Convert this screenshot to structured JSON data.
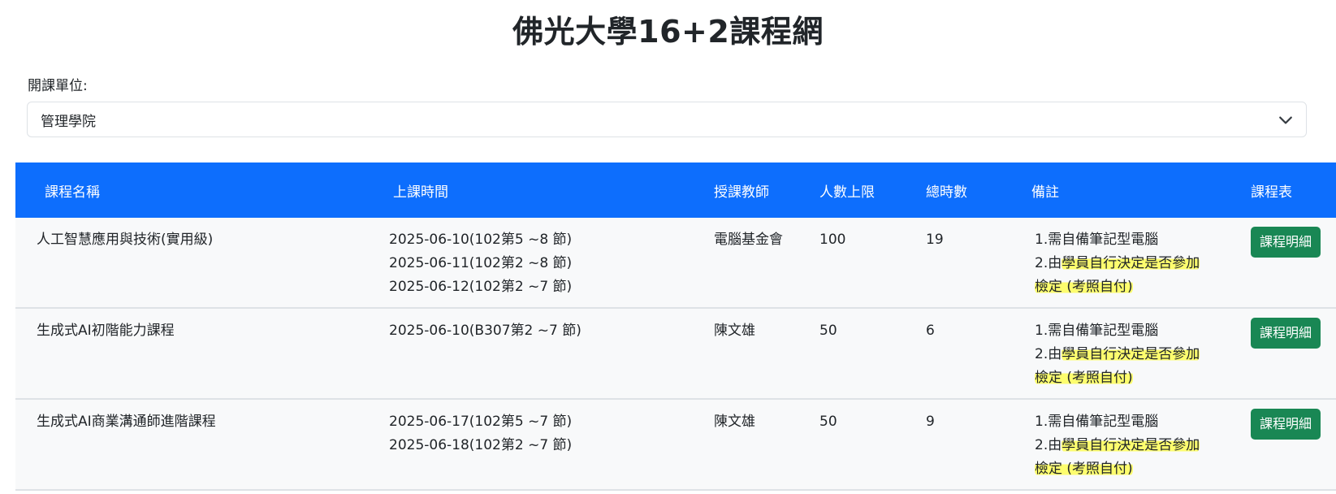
{
  "page": {
    "title": "佛光大學16+2課程網"
  },
  "filter": {
    "label": "開課單位:",
    "selected": "管理學院"
  },
  "table": {
    "headers": [
      "課程名稱",
      "上課時間",
      "授課教師",
      "人數上限",
      "總時數",
      "備註",
      "課程表"
    ],
    "rows": [
      {
        "name": "人工智慧應用與技術(實用級)",
        "times": [
          "2025-06-10(102第5 ~8 節)",
          "2025-06-11(102第2 ~8 節)",
          "2025-06-12(102第2 ~7 節)"
        ],
        "teacher": "電腦基金會",
        "capacity": "100",
        "hours": "19",
        "notes": {
          "line1": "1.需自備筆記型電腦",
          "line2a": "2.由",
          "line2b": "學員自行決定是否參加",
          "line3": "檢定 (考照自付)"
        },
        "button": "課程明細"
      },
      {
        "name": "生成式AI初階能力課程",
        "times": [
          "2025-06-10(B307第2 ~7 節)"
        ],
        "teacher": "陳文雄",
        "capacity": "50",
        "hours": "6",
        "notes": {
          "line1": "1.需自備筆記型電腦",
          "line2a": "2.由",
          "line2b": "學員自行決定是否參加",
          "line3": "檢定 (考照自付)"
        },
        "button": "課程明細"
      },
      {
        "name": "生成式AI商業溝通師進階課程",
        "times": [
          "2025-06-17(102第5 ~7 節)",
          "2025-06-18(102第2 ~7 節)"
        ],
        "teacher": "陳文雄",
        "capacity": "50",
        "hours": "9",
        "notes": {
          "line1": "1.需自備筆記型電腦",
          "line2a": "2.由",
          "line2b": "學員自行決定是否參加",
          "line3": "檢定 (考照自付)"
        },
        "button": "課程明細"
      }
    ]
  },
  "colors": {
    "header_bg": "#0d6efd",
    "button_bg": "#198754",
    "highlight": "#fdfd6e"
  },
  "icons": {
    "select_arrow": "chevron-down-icon"
  }
}
